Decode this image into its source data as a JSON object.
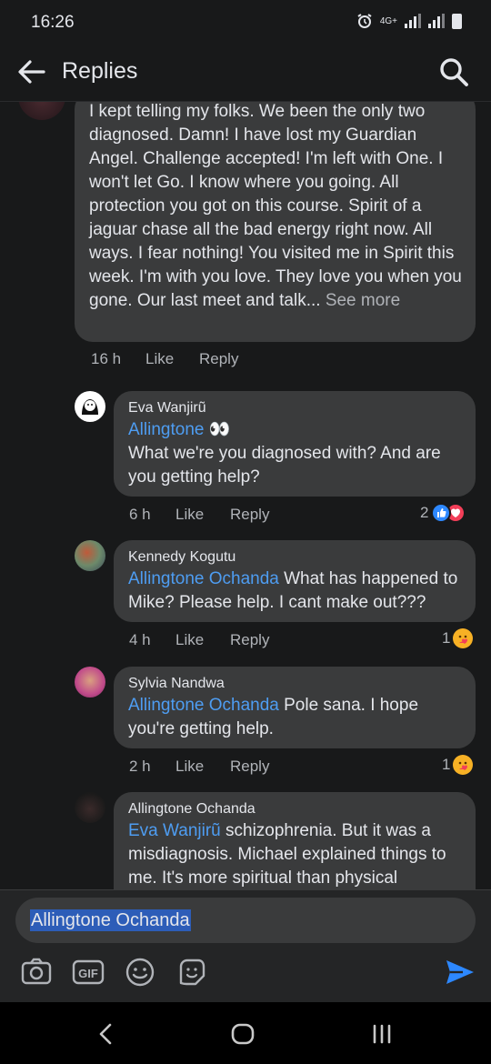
{
  "status_bar": {
    "time": "16:26",
    "network": "4G+"
  },
  "header": {
    "title": "Replies"
  },
  "top_comment": {
    "text": "I kept telling my folks. We been the only two diagnosed. Damn! I have lost my Guardian Angel. Challenge accepted! I'm left with One. I won't let Go. I know where you going. All protection you got on this course. Spirit of a jaguar chase all the bad energy right now. All ways. I fear nothing! You visited me in Spirit this week. I'm with you love. They love you when you gone. Our last meet and talk...",
    "see_more": "See more",
    "time": "16 h",
    "like": "Like",
    "reply": "Reply"
  },
  "replies": [
    {
      "author": "Eva Wanjirũ",
      "mention": "Allingtone",
      "emoji": "👀",
      "text": "What we're you diagnosed with? And are you getting help?",
      "time": "6 h",
      "like": "Like",
      "reply": "Reply",
      "reaction_count": "2",
      "reactions": [
        "like-icon",
        "love-icon"
      ]
    },
    {
      "author": "Kennedy Kogutu",
      "mention": "Allingtone Ochanda",
      "text": " What has happened to Mike? Please help. I cant make out???",
      "time": "4 h",
      "like": "Like",
      "reply": "Reply",
      "reaction_count": "1",
      "reactions": [
        "care-icon"
      ]
    },
    {
      "author": "Sylvia Nandwa",
      "mention": "Allingtone Ochanda",
      "text": " Pole sana. I hope you're getting help.",
      "time": "2 h",
      "like": "Like",
      "reply": "Reply",
      "reaction_count": "1",
      "reactions": [
        "care-icon"
      ]
    },
    {
      "author": "Allingtone Ochanda",
      "mention": "Eva Wanjirũ",
      "text": " schizophrenia.  But it was a misdiagnosis. Michael explained things to me. It's more spiritual than physical"
    }
  ],
  "composer": {
    "value": "Allingtone Ochanda"
  },
  "colors": {
    "background": "#18191a",
    "bubble": "#3a3b3c",
    "mention": "#4e9df2",
    "send": "#2d88ff"
  }
}
